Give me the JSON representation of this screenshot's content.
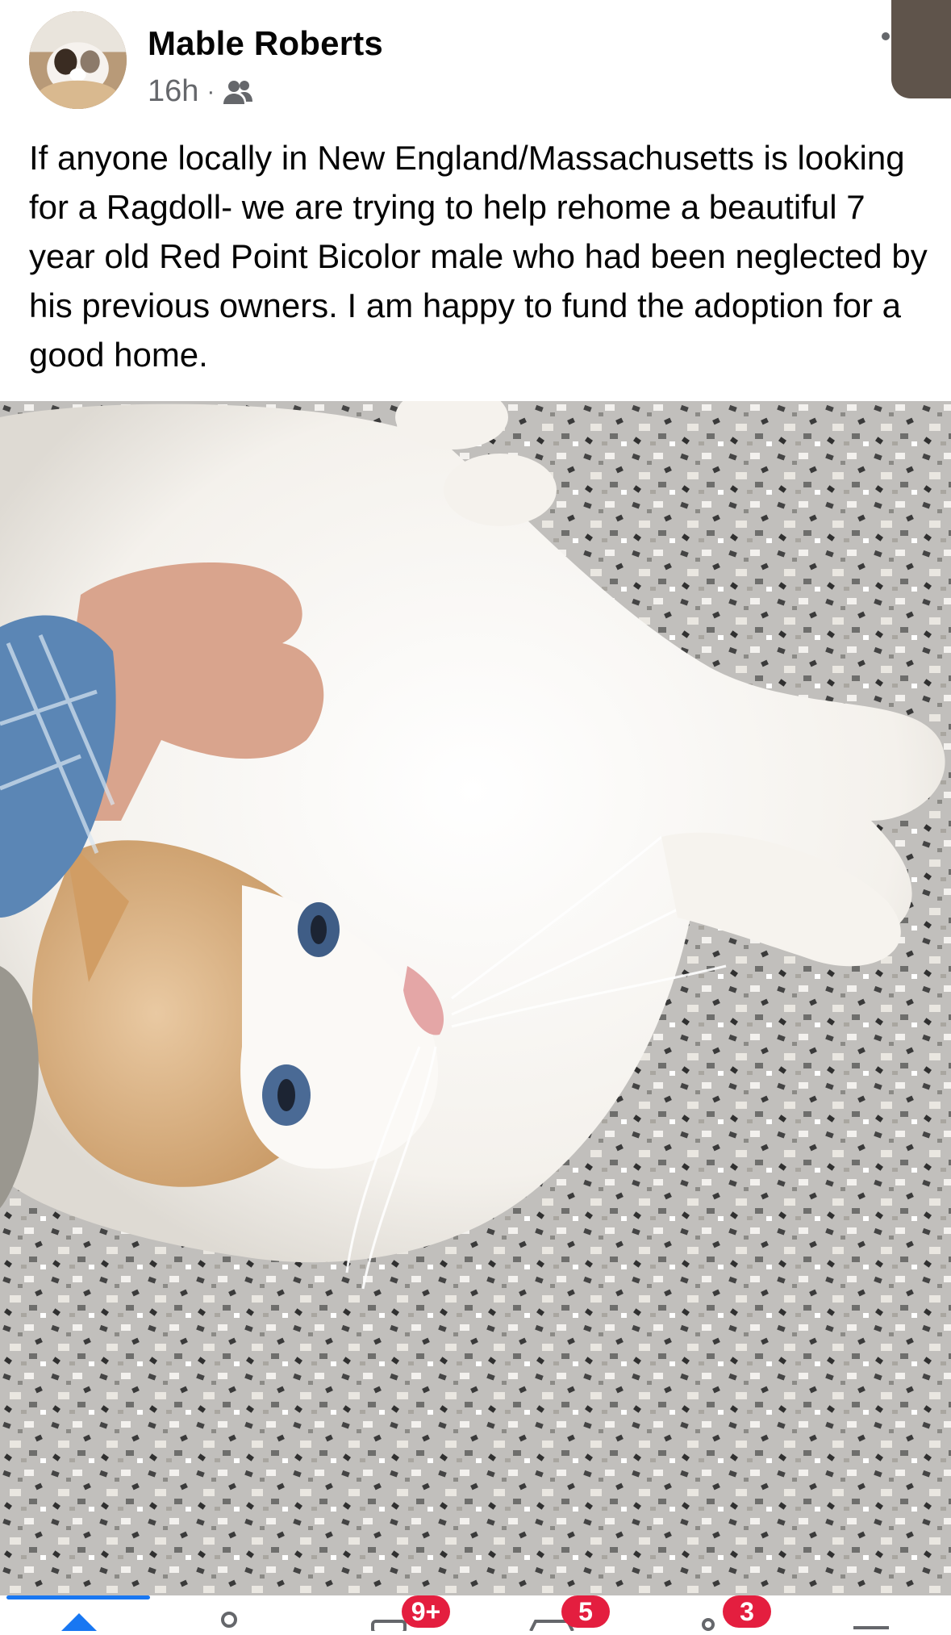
{
  "post": {
    "author": "Mable Roberts",
    "time": "16h",
    "separator": "·",
    "audience_icon": "friends-icon",
    "text": "If anyone locally in New England/Massachusetts is looking for a Ragdoll- we are trying to help rehome a beautiful 7 year old Red Point Bicolor male who had been neglected by his previous owners. I am happy to fund the adoption for a good home."
  },
  "nav": {
    "items": [
      {
        "icon": "home-icon",
        "badge": ""
      },
      {
        "icon": "friends-icon",
        "badge": ""
      },
      {
        "icon": "video-icon",
        "badge": "9+"
      },
      {
        "icon": "marketplace-icon",
        "badge": "5"
      },
      {
        "icon": "groups-icon",
        "badge": "3"
      },
      {
        "icon": "menu-icon",
        "badge": ""
      }
    ]
  },
  "colors": {
    "accent": "#1877f2",
    "badge": "#e41e3f",
    "meta": "#65676b"
  }
}
